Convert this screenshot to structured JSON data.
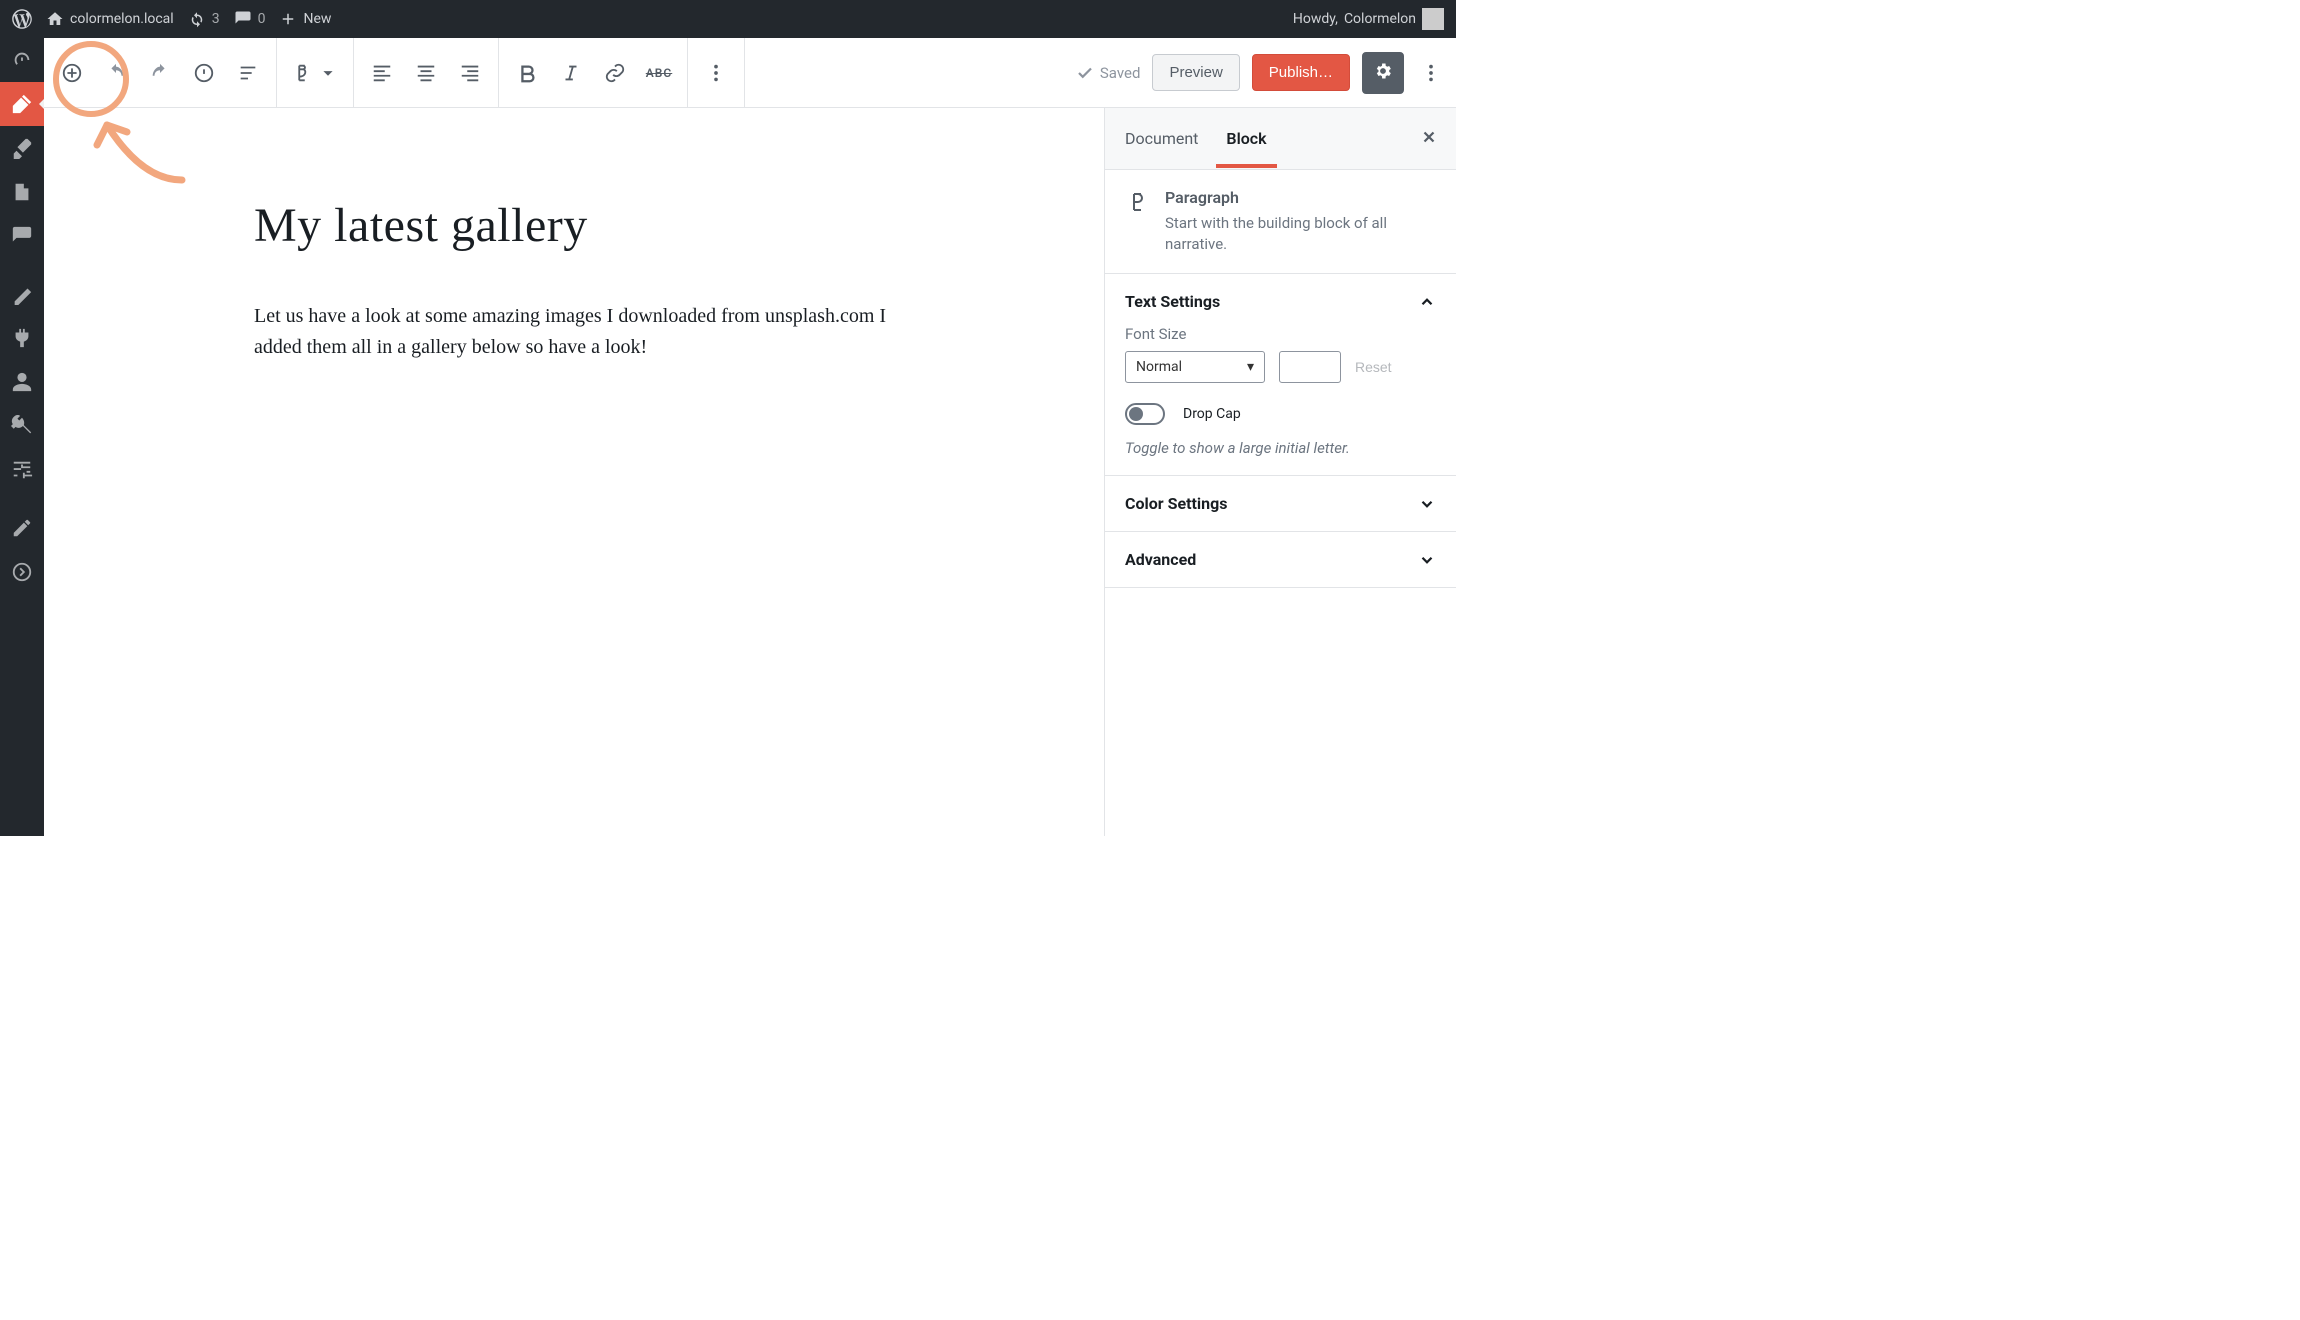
{
  "adminbar": {
    "site_name": "colormelon.local",
    "updates_count": "3",
    "comments_count": "0",
    "new_label": "New",
    "howdy_prefix": "Howdy, ",
    "user_name": "Colormelon"
  },
  "toolbar": {
    "saved_label": "Saved",
    "preview_label": "Preview",
    "publish_label": "Publish…",
    "strike_label": "ABC"
  },
  "post": {
    "title": "My latest gallery",
    "paragraph": "Let us have a look at some amazing images I downloaded from unsplash.com I added them all in a gallery below so have a look!"
  },
  "sidebar": {
    "tabs": {
      "document": "Document",
      "block": "Block"
    },
    "block_type": {
      "title": "Paragraph",
      "description": "Start with the building block of all narrative."
    },
    "panels": {
      "text_settings": {
        "title": "Text Settings",
        "font_size_label": "Font Size",
        "font_size_value": "Normal",
        "reset_label": "Reset",
        "drop_cap_label": "Drop Cap",
        "drop_cap_help": "Toggle to show a large initial letter."
      },
      "color_settings": {
        "title": "Color Settings"
      },
      "advanced": {
        "title": "Advanced"
      }
    }
  }
}
